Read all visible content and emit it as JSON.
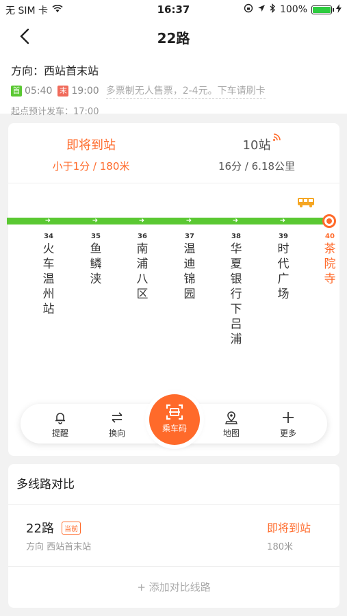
{
  "status_bar": {
    "carrier": "无 SIM 卡",
    "time": "16:37",
    "battery": "100%",
    "icons": [
      "wifi-icon",
      "lock-rotation-icon",
      "location-icon",
      "bluetooth-icon",
      "battery-icon",
      "charging-icon"
    ]
  },
  "nav": {
    "title": "22路",
    "back_icon": "back-chevron-icon"
  },
  "info": {
    "direction": "方向：西站首末站",
    "first_tag": "首",
    "first_time": "05:40",
    "last_tag": "末",
    "last_time": "19:00",
    "fare_note": "多票制无人售票，2-4元。下车请刷卡",
    "predict": "起点预计发车：17:00"
  },
  "arrival": {
    "first": {
      "status": "即将到站",
      "detail": "小于1分 / 180米"
    },
    "second": {
      "status": "10站",
      "detail": "16分 / 6.18公里"
    }
  },
  "stops": [
    {
      "num": "34",
      "name": "火车温州站"
    },
    {
      "num": "35",
      "name": "鱼鳞浃"
    },
    {
      "num": "36",
      "name": "南浦八区"
    },
    {
      "num": "37",
      "name": "温迪锦园"
    },
    {
      "num": "38",
      "name": "华夏银行下吕浦"
    },
    {
      "num": "39",
      "name": "时代广场"
    },
    {
      "num": "40",
      "name": "茶院寺"
    }
  ],
  "toolbar": {
    "remind": "提醒",
    "switch": "换向",
    "ride_code": "乘车码",
    "map": "地图",
    "more": "更多"
  },
  "compare": {
    "header": "多线路对比",
    "line_name": "22路",
    "badge": "当前",
    "line_direction": "方向  西站首末站",
    "line_status": "即将到站",
    "line_distance": "180米",
    "add_label": "+ 添加对比线路"
  },
  "colors": {
    "accent": "#ff6a2a",
    "track": "#5ac832",
    "first_tag": "#5ac832",
    "last_tag": "#f06a5a"
  }
}
